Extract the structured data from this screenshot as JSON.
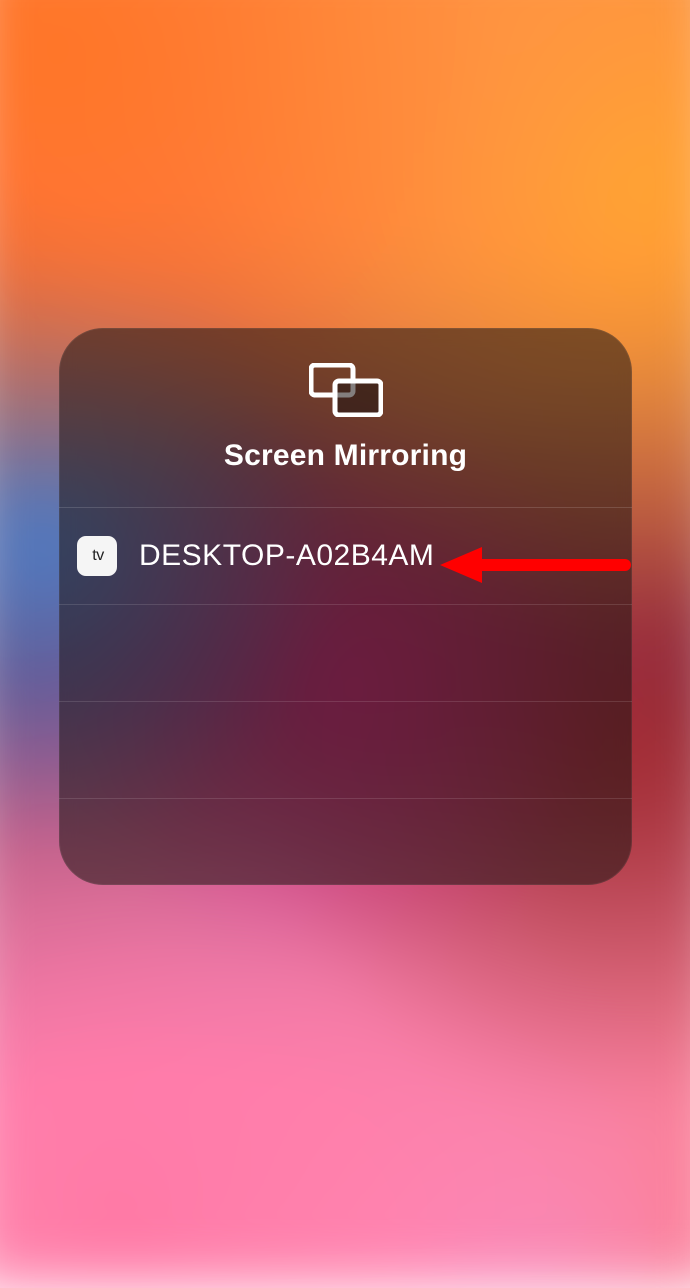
{
  "panel": {
    "title": "Screen Mirroring",
    "icon": "screen-mirroring-icon"
  },
  "devices": [
    {
      "name": "DESKTOP-A02B4AM",
      "type": "appletv"
    }
  ],
  "annotation": {
    "arrow_color": "#ff0000"
  }
}
